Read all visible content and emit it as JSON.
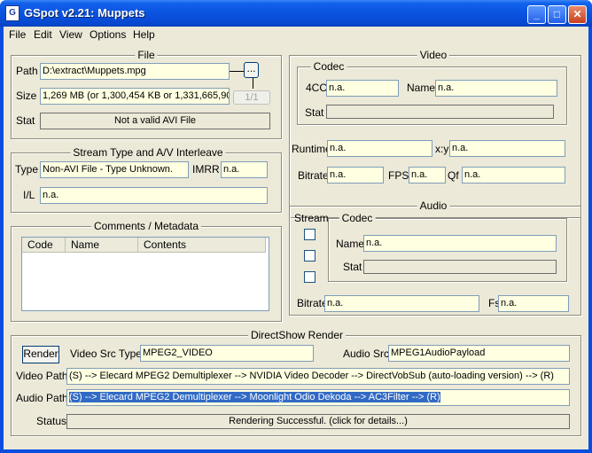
{
  "window": {
    "title": "GSpot v2.21: Muppets",
    "icon": "gspot-app-icon"
  },
  "menu": [
    "File",
    "Edit",
    "View",
    "Options",
    "Help"
  ],
  "file": {
    "legend": "File",
    "path_label": "Path",
    "path": "D:\\extract\\Muppets.mpg",
    "browse": "...",
    "size_label": "Size",
    "size": "1,269 MB (or 1,300,454 KB or 1,331,665,90",
    "page": "1/1",
    "stat_label": "Stat",
    "stat": "Not a valid AVI File"
  },
  "stream": {
    "legend": "Stream Type and A/V Interleave",
    "type_label": "Type",
    "type": "Non-AVI File - Type Unknown.",
    "imrr_label": "IMRR",
    "imrr": "n.a.",
    "il_label": "I/L",
    "il": "n.a."
  },
  "comments": {
    "legend": "Comments / Metadata",
    "columns": [
      "Code",
      "Name",
      "Contents"
    ]
  },
  "video": {
    "legend": "Video",
    "codec_legend": "Codec",
    "cc_label": "4CC",
    "cc": "n.a.",
    "name_label": "Name",
    "name": "n.a.",
    "stat_label": "Stat",
    "stat": "",
    "runtime_label": "Runtime",
    "runtime": "n.a.",
    "xy_label": "x:y",
    "xy": "n.a.",
    "bitrate_label": "Bitrate",
    "bitrate": "n.a.",
    "fps_label": "FPS",
    "fps": "n.a.",
    "qf_label": "Qf",
    "qf": "n.a."
  },
  "audio": {
    "legend": "Audio",
    "stream_label": "Stream",
    "codec_legend": "Codec",
    "name_label": "Name",
    "name": "n.a.",
    "stat_label": "Stat",
    "stat": "",
    "bitrate_label": "Bitrate",
    "bitrate": "n.a.",
    "fs_label": "Fs",
    "fs": "n.a."
  },
  "render": {
    "legend": "DirectShow Render",
    "button": "Render",
    "video_src_label": "Video Src Type",
    "video_src": "MPEG2_VIDEO",
    "audio_src_label": "Audio Src",
    "audio_src": "MPEG1AudioPayload",
    "video_path_label": "Video Path",
    "video_path": "(S) --> Elecard MPEG2 Demultiplexer --> NVIDIA Video Decoder --> DirectVobSub (auto-loading version) --> (R)",
    "audio_path_label": "Audio Path",
    "audio_path": "(S) --> Elecard MPEG2 Demultiplexer --> Moonlight Odio Dekoda --> AC3Filter --> (R)",
    "status_label": "Status",
    "status": "Rendering Successful.  (click for details...)"
  }
}
